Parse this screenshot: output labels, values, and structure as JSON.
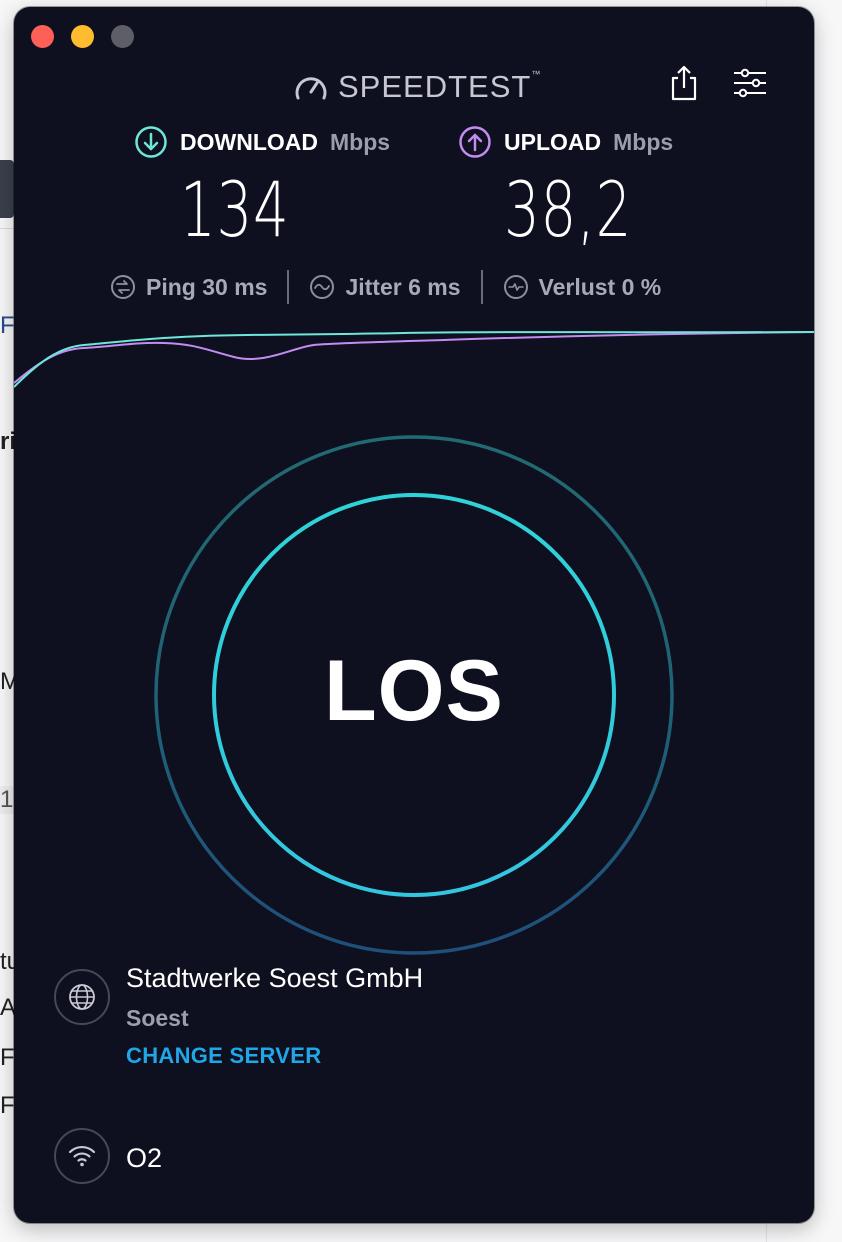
{
  "app": {
    "logo_text": "SPEEDTEST",
    "trademark": "™"
  },
  "download": {
    "label": "DOWNLOAD",
    "unit": "Mbps",
    "value": "134",
    "icon": "download-arrow-icon"
  },
  "upload": {
    "label": "UPLOAD",
    "unit": "Mbps",
    "value": "38,2",
    "icon": "upload-arrow-icon"
  },
  "stats": {
    "ping": "Ping 30 ms",
    "jitter": "Jitter 6 ms",
    "loss": "Verlust 0 %"
  },
  "go_button": {
    "label": "LOS"
  },
  "server": {
    "name": "Stadtwerke Soest GmbH",
    "location": "Soest",
    "change_label": "CHANGE SERVER"
  },
  "connection": {
    "provider": "O2"
  },
  "colors": {
    "background": "#0e0f1f",
    "download_accent": "#6ee7d8",
    "upload_accent": "#c28cf0",
    "ring_inner": "#33d3dc",
    "link": "#1fa7e8"
  },
  "background_window_fragments": [
    "Fe",
    "ri",
    "M",
    "1",
    "tu",
    "AN",
    "F",
    "F"
  ]
}
